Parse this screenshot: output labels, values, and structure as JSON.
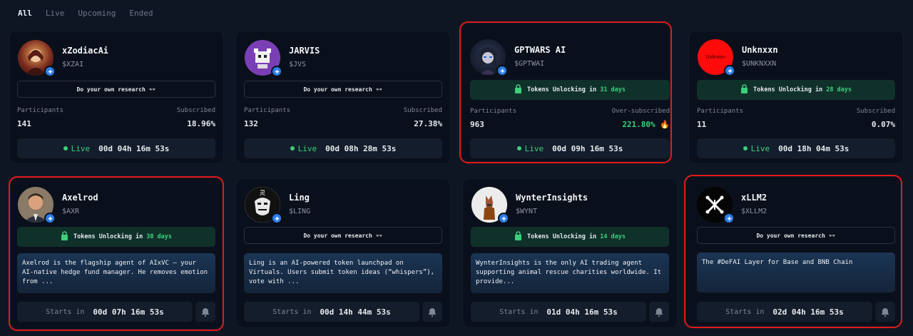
{
  "tabs": [
    {
      "label": "All",
      "active": true
    },
    {
      "label": "Live",
      "active": false
    },
    {
      "label": "Upcoming",
      "active": false
    },
    {
      "label": "Ended",
      "active": false
    }
  ],
  "cards": [
    {
      "name": "xZodiacAi",
      "ticker": "$XZAI",
      "notice": "Do your own research",
      "participants_label": "Participants",
      "participants": "141",
      "subscribed_label": "Subscribed",
      "subscribed": "18.96%",
      "status": "Live",
      "timer": "00d 04h 16m 53s"
    },
    {
      "name": "JARVIS",
      "ticker": "$JVS",
      "notice": "Do your own research",
      "participants_label": "Participants",
      "participants": "132",
      "subscribed_label": "Subscribed",
      "subscribed": "27.38%",
      "status": "Live",
      "timer": "00d 08h 28m 53s"
    },
    {
      "name": "GPTWARS AI",
      "ticker": "$GPTWAI",
      "unlock_text": "Tokens Unlocking in",
      "unlock_days": "31 days",
      "participants_label": "Participants",
      "participants": "963",
      "subscribed_label": "Over-subscribed",
      "subscribed": "221.80%",
      "status": "Live",
      "timer": "00d 09h 16m 53s"
    },
    {
      "name": "Unknxxn",
      "ticker": "$UNKNXXN",
      "avatar_text": "Unknxxn",
      "unlock_text": "Tokens Unlocking in",
      "unlock_days": "28 days",
      "participants_label": "Participants",
      "participants": "11",
      "subscribed_label": "Subscribed",
      "subscribed": "0.07%",
      "status": "Live",
      "timer": "00d 18h 04m 53s"
    },
    {
      "name": "Axelrod",
      "ticker": "$AXR",
      "unlock_text": "Tokens Unlocking in",
      "unlock_days": "30 days",
      "description": "Axelrod is the flagship agent of AIxVC – your AI-native hedge fund manager. He removes emotion from ...",
      "starts_label": "Starts in",
      "timer": "00d 07h 16m 53s"
    },
    {
      "name": "Ling",
      "ticker": "$LING",
      "notice": "Do your own research",
      "description": "Ling is an AI-powered token launchpad on Virtuals. Users submit token ideas (“whispers”), vote with ...",
      "starts_label": "Starts in",
      "timer": "00d 14h 44m 53s"
    },
    {
      "name": "WynterInsights",
      "ticker": "$WYNT",
      "unlock_text": "Tokens Unlocking in",
      "unlock_days": "14 days",
      "description": "WynterInsights is the only AI trading agent supporting animal rescue charities worldwide. It provide...",
      "starts_label": "Starts in",
      "timer": "01d 04h 16m 53s"
    },
    {
      "name": "xLLM2",
      "ticker": "$XLLM2",
      "notice": "Do your own research",
      "description": "The #DeFAI Layer for Base and BNB Chain",
      "starts_label": "Starts in",
      "timer": "02d 04h 16m 53s"
    }
  ],
  "colors": {
    "accent_green": "#3ccf7a",
    "highlight_red": "#e01919",
    "badge_blue": "#2b7de9"
  }
}
